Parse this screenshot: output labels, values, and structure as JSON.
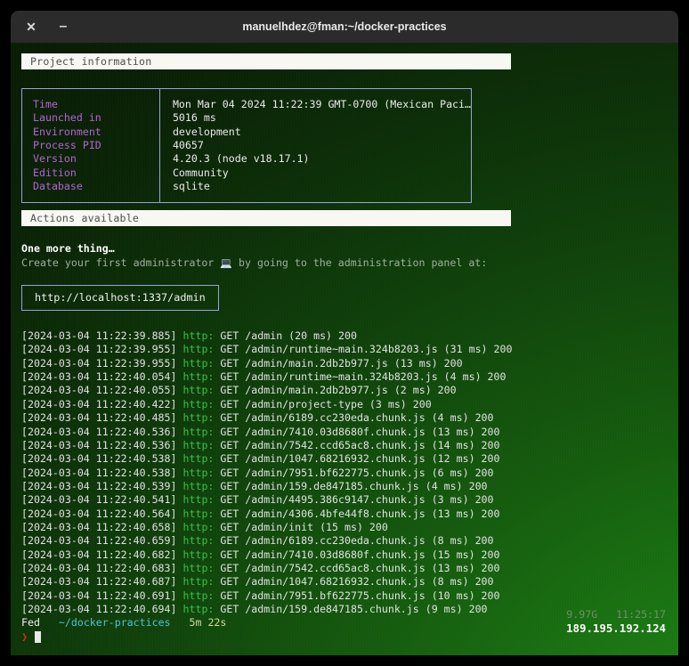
{
  "window": {
    "title": "manuelhdez@fman:~/docker-practices",
    "close_label": "✕",
    "minimize_label": "–"
  },
  "sections": {
    "project_information_header": "Project information",
    "actions_available_header": "Actions available"
  },
  "project_info": {
    "rows": [
      {
        "key": "Time",
        "value": "Mon Mar 04 2024 11:22:39 GMT-0700 (Mexican Paci…"
      },
      {
        "key": "Launched in",
        "value": "5016 ms"
      },
      {
        "key": "Environment",
        "value": "development"
      },
      {
        "key": "Process PID",
        "value": "40657"
      },
      {
        "key": "Version",
        "value": "4.20.3 (node v18.17.1)"
      },
      {
        "key": "Edition",
        "value": "Community"
      },
      {
        "key": "Database",
        "value": "sqlite"
      }
    ]
  },
  "actions": {
    "one_more_thing": "One more thing…",
    "create_admin_prefix": "Create your first administrator ",
    "create_admin_emoji": "💻",
    "create_admin_suffix": " by going to the administration panel at:",
    "admin_url": "http://localhost:1337/admin"
  },
  "logs": [
    {
      "timestamp": "[2024-03-04 11:22:39.885]",
      "level": "http:",
      "message": " GET /admin (20 ms) 200"
    },
    {
      "timestamp": "[2024-03-04 11:22:39.955]",
      "level": "http:",
      "message": " GET /admin/runtime~main.324b8203.js (31 ms) 200"
    },
    {
      "timestamp": "[2024-03-04 11:22:39.955]",
      "level": "http:",
      "message": " GET /admin/main.2db2b977.js (13 ms) 200"
    },
    {
      "timestamp": "[2024-03-04 11:22:40.054]",
      "level": "http:",
      "message": " GET /admin/runtime~main.324b8203.js (4 ms) 200"
    },
    {
      "timestamp": "[2024-03-04 11:22:40.055]",
      "level": "http:",
      "message": " GET /admin/main.2db2b977.js (2 ms) 200"
    },
    {
      "timestamp": "[2024-03-04 11:22:40.422]",
      "level": "http:",
      "message": " GET /admin/project-type (3 ms) 200"
    },
    {
      "timestamp": "[2024-03-04 11:22:40.485]",
      "level": "http:",
      "message": " GET /admin/6189.cc230eda.chunk.js (4 ms) 200"
    },
    {
      "timestamp": "[2024-03-04 11:22:40.536]",
      "level": "http:",
      "message": " GET /admin/7410.03d8680f.chunk.js (13 ms) 200"
    },
    {
      "timestamp": "[2024-03-04 11:22:40.536]",
      "level": "http:",
      "message": " GET /admin/7542.ccd65ac8.chunk.js (14 ms) 200"
    },
    {
      "timestamp": "[2024-03-04 11:22:40.538]",
      "level": "http:",
      "message": " GET /admin/1047.68216932.chunk.js (12 ms) 200"
    },
    {
      "timestamp": "[2024-03-04 11:22:40.538]",
      "level": "http:",
      "message": " GET /admin/7951.bf622775.chunk.js (6 ms) 200"
    },
    {
      "timestamp": "[2024-03-04 11:22:40.539]",
      "level": "http:",
      "message": " GET /admin/159.de847185.chunk.js (4 ms) 200"
    },
    {
      "timestamp": "[2024-03-04 11:22:40.541]",
      "level": "http:",
      "message": " GET /admin/4495.386c9147.chunk.js (3 ms) 200"
    },
    {
      "timestamp": "[2024-03-04 11:22:40.564]",
      "level": "http:",
      "message": " GET /admin/4306.4bfe44f8.chunk.js (13 ms) 200"
    },
    {
      "timestamp": "[2024-03-04 11:22:40.658]",
      "level": "http:",
      "message": " GET /admin/init (15 ms) 200"
    },
    {
      "timestamp": "[2024-03-04 11:22:40.659]",
      "level": "http:",
      "message": " GET /admin/6189.cc230eda.chunk.js (8 ms) 200"
    },
    {
      "timestamp": "[2024-03-04 11:22:40.682]",
      "level": "http:",
      "message": " GET /admin/7410.03d8680f.chunk.js (15 ms) 200"
    },
    {
      "timestamp": "[2024-03-04 11:22:40.683]",
      "level": "http:",
      "message": " GET /admin/7542.ccd65ac8.chunk.js (13 ms) 200"
    },
    {
      "timestamp": "[2024-03-04 11:22:40.687]",
      "level": "http:",
      "message": " GET /admin/1047.68216932.chunk.js (8 ms) 200"
    },
    {
      "timestamp": "[2024-03-04 11:22:40.691]",
      "level": "http:",
      "message": " GET /admin/7951.bf622775.chunk.js (10 ms) 200"
    },
    {
      "timestamp": "[2024-03-04 11:22:40.694]",
      "level": "http:",
      "message": " GET /admin/159.de847185.chunk.js (9 ms) 200"
    }
  ],
  "prompt": {
    "user": "Fed",
    "path": "~/docker-practices",
    "duration": "5m 22s",
    "caret": "❯",
    "input_value": ""
  },
  "status": {
    "memory": "9.97G",
    "clock": "11:25:17",
    "ip_address": "189.195.192.124"
  },
  "colors": {
    "accent_green": "#37c24a",
    "label_purple": "#b563d6",
    "box_border": "#9aa4d4",
    "path_cyan": "#4fc3d9",
    "caret_red": "#d32a2a",
    "header_bg": "#f7f8f2"
  }
}
